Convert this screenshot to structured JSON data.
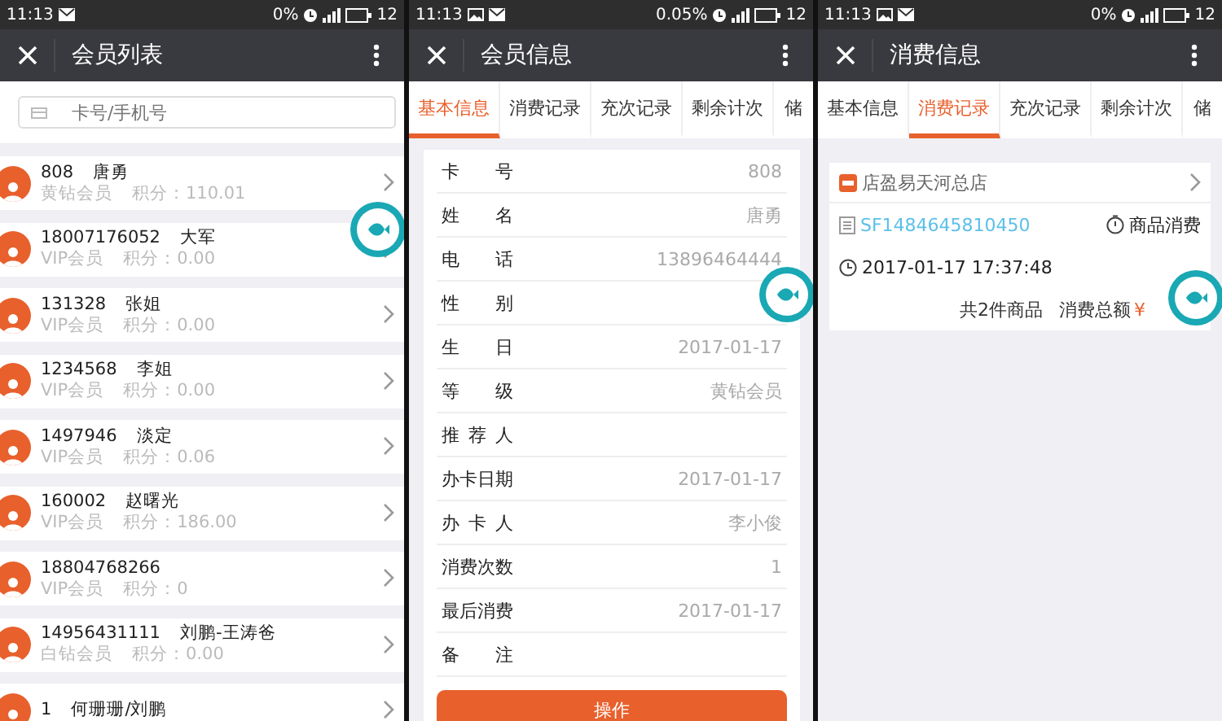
{
  "screens": [
    {
      "kind": "member_list",
      "status_bar": {
        "time": "11:13",
        "notices": [
          {
            "kind": "mail"
          }
        ],
        "percent": "0%",
        "battery": "12"
      },
      "title": "会员列表",
      "search": {
        "placeholder": "卡号/手机号"
      },
      "members": [
        {
          "card": "808",
          "name": "唐勇",
          "level": "黄钻会员",
          "points": "积分：110.01"
        },
        {
          "card": "18007176052",
          "name": "大军",
          "level": "VIP会员",
          "points": "积分：0.00"
        },
        {
          "card": "131328",
          "name": "张姐",
          "level": "VIP会员",
          "points": "积分：0.00"
        },
        {
          "card": "1234568",
          "name": "李姐",
          "level": "VIP会员",
          "points": "积分：0.00"
        },
        {
          "card": "1497946",
          "name": "淡定",
          "level": "VIP会员",
          "points": "积分：0.06"
        },
        {
          "card": "160002",
          "name": "赵曙光",
          "level": "VIP会员",
          "points": "积分：186.00"
        },
        {
          "card": "18804768266",
          "level": "VIP会员",
          "points": "积分：0"
        },
        {
          "card": "14956431111",
          "name": "刘鹏-王涛爸",
          "level": "白钻会员",
          "points": "积分：0.00"
        },
        {
          "card": "1",
          "name": "何珊珊/刘鹏"
        }
      ]
    },
    {
      "kind": "member_info",
      "status_bar": {
        "time": "11:13",
        "notices": [
          {
            "kind": "image"
          },
          {
            "kind": "mail"
          }
        ],
        "percent": "0.05%",
        "battery": "12"
      },
      "title": "会员信息",
      "tabs": [
        {
          "label": "基本信息",
          "selected": true
        },
        {
          "label": "消费记录",
          "selected": false
        },
        {
          "label": "充次记录",
          "selected": false
        },
        {
          "label": "剩余计次",
          "selected": false
        },
        {
          "label": "储",
          "selected": false
        }
      ],
      "fields": [
        {
          "label": "卡号",
          "value": "808"
        },
        {
          "label": "姓名",
          "value": "唐勇"
        },
        {
          "label": "电话",
          "value": "13896464444"
        },
        {
          "label": "性别"
        },
        {
          "label": "生日",
          "value": "2017-01-17"
        },
        {
          "label": "等级",
          "value": "黄钻会员"
        },
        {
          "label": "推荐人"
        },
        {
          "label": "办卡日期",
          "value": "2017-01-17"
        },
        {
          "label": "办卡人",
          "value": "李小俊"
        },
        {
          "label": "消费次数",
          "value": "1"
        },
        {
          "label": "最后消费",
          "value": "2017-01-17"
        },
        {
          "label": "备注"
        }
      ],
      "action_button": "操作"
    },
    {
      "kind": "consumption",
      "status_bar": {
        "time": "11:13",
        "notices": [
          {
            "kind": "image"
          },
          {
            "kind": "mail"
          }
        ],
        "percent": "0%",
        "battery": "12"
      },
      "title": "消费信息",
      "tabs": [
        {
          "label": "基本信息",
          "selected": false
        },
        {
          "label": "消费记录",
          "selected": true
        },
        {
          "label": "充次记录",
          "selected": false
        },
        {
          "label": "剩余计次",
          "selected": false
        },
        {
          "label": "储",
          "selected": false
        }
      ],
      "record": {
        "store": "店盈易天河总店",
        "order_no": "SF1484645810450",
        "type": "商品消费",
        "time": "2017-01-17 17:37:48",
        "items": "共2件商品",
        "total_label": "消费总额",
        "currency": "¥"
      }
    }
  ]
}
